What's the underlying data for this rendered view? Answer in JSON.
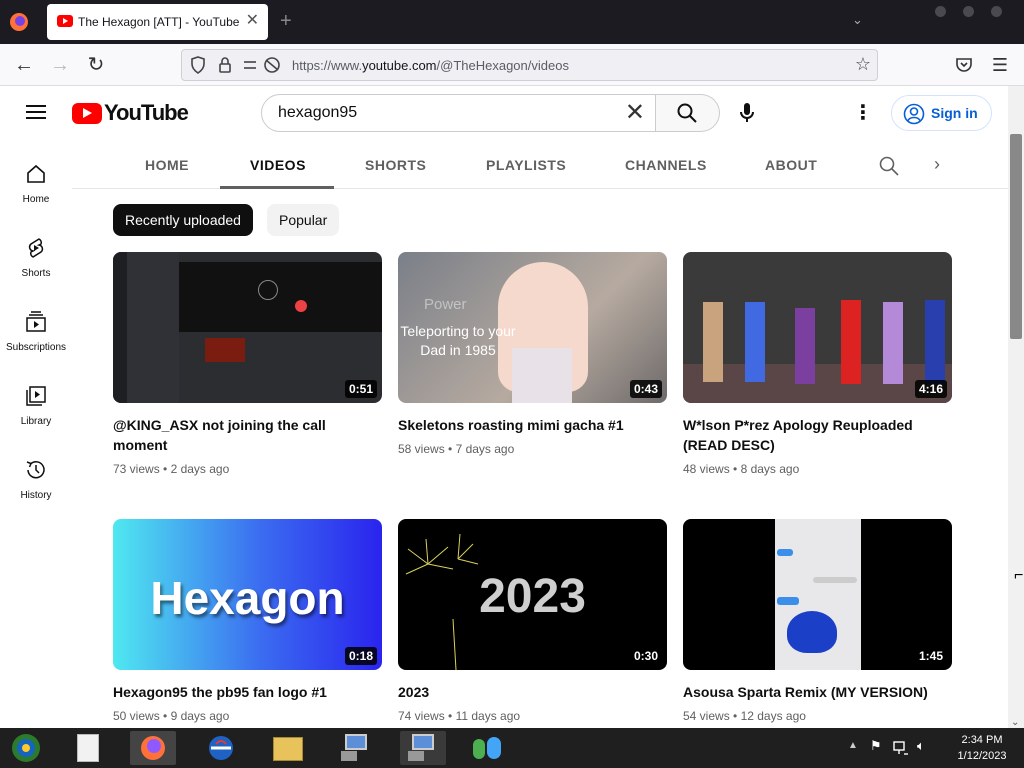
{
  "browser": {
    "tab_title": "The Hexagon [ATT] - YouTube",
    "new_tab_symbol": "+",
    "url_prefix": "https://www.",
    "url_domain": "youtube.com",
    "url_path": "/@TheHexagon/videos"
  },
  "youtube": {
    "logo_text": "YouTube",
    "search_value": "hexagon95",
    "signin_label": "Sign in"
  },
  "guide": [
    {
      "label": "Home",
      "icon": "home-icon"
    },
    {
      "label": "Shorts",
      "icon": "shorts-icon"
    },
    {
      "label": "Subscriptions",
      "icon": "subscriptions-icon"
    },
    {
      "label": "Library",
      "icon": "library-icon"
    },
    {
      "label": "History",
      "icon": "history-icon"
    }
  ],
  "channel_tabs": [
    "HOME",
    "VIDEOS",
    "SHORTS",
    "PLAYLISTS",
    "CHANNELS",
    "ABOUT"
  ],
  "chips": [
    "Recently uploaded",
    "Popular"
  ],
  "videos": [
    {
      "title": "@KING_ASX not joining the call moment",
      "duration": "0:51",
      "views": "73 views",
      "age": "2 days ago"
    },
    {
      "title": "Skeletons roasting mimi gacha #1",
      "duration": "0:43",
      "views": "58 views",
      "age": "7 days ago",
      "thumb_text": "Teleporting to your Dad in 1985",
      "thumb_text_faded": "Power"
    },
    {
      "title": "W*lson P*rez Apology Reuploaded (READ DESC)",
      "duration": "4:16",
      "views": "48 views",
      "age": "8 days ago"
    },
    {
      "title": "Hexagon95 the pb95 fan logo #1",
      "duration": "0:18",
      "views": "50 views",
      "age": "9 days ago",
      "thumb_text": "Hexagon"
    },
    {
      "title": "2023",
      "duration": "0:30",
      "views": "74 views",
      "age": "11 days ago",
      "thumb_text": "2023"
    },
    {
      "title": "Asousa Sparta Remix (MY VERSION)",
      "duration": "1:45",
      "views": "54 views",
      "age": "12 days ago"
    }
  ],
  "taskbar": {
    "time": "2:34 PM",
    "date": "1/12/2023"
  },
  "colors": {
    "brand_red": "#ff0000",
    "link_blue": "#065fd4",
    "browser_dark": "#1c1b22"
  }
}
